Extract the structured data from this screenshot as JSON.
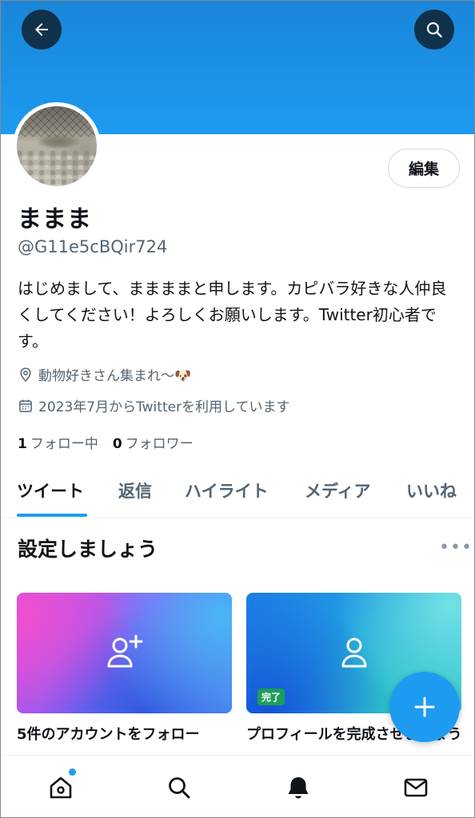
{
  "profile": {
    "display_name": "ままま",
    "handle": "@G11e5cBQir724",
    "bio": "はじめまして、ままままと申します。カピバラ好きな人仲良くしてください！よろしくお願いします。Twitter初心者です。",
    "location": "動物好きさん集まれ〜🐶",
    "joined": "2023年7月からTwitterを利用しています",
    "following_count": "1",
    "following_label": "フォロー中",
    "followers_count": "0",
    "followers_label": "フォロワー",
    "edit_label": "編集"
  },
  "tabs": [
    {
      "label": "ツイート",
      "active": true
    },
    {
      "label": "返信",
      "active": false
    },
    {
      "label": "ハイライト",
      "active": false
    },
    {
      "label": "メディア",
      "active": false
    },
    {
      "label": "いいね",
      "active": false
    }
  ],
  "setup": {
    "title": "設定しましょう",
    "more": "•••",
    "cards": [
      {
        "label": "5件のアカウントをフォロー"
      },
      {
        "label": "プロフィールを完成させましょう",
        "badge": "完了"
      }
    ]
  },
  "icons": {
    "back": "arrow-left-icon",
    "search": "search-icon",
    "location": "location-pin-icon",
    "calendar": "calendar-icon",
    "add_user": "person-add-icon",
    "user": "person-icon",
    "compose": "plus-icon",
    "home": "home-icon",
    "bell": "bell-icon",
    "mail": "mail-icon"
  },
  "colors": {
    "accent": "#1d9bf0",
    "text_primary": "#0f1419",
    "text_secondary": "#536471",
    "badge_green": "#1c9e5a"
  }
}
